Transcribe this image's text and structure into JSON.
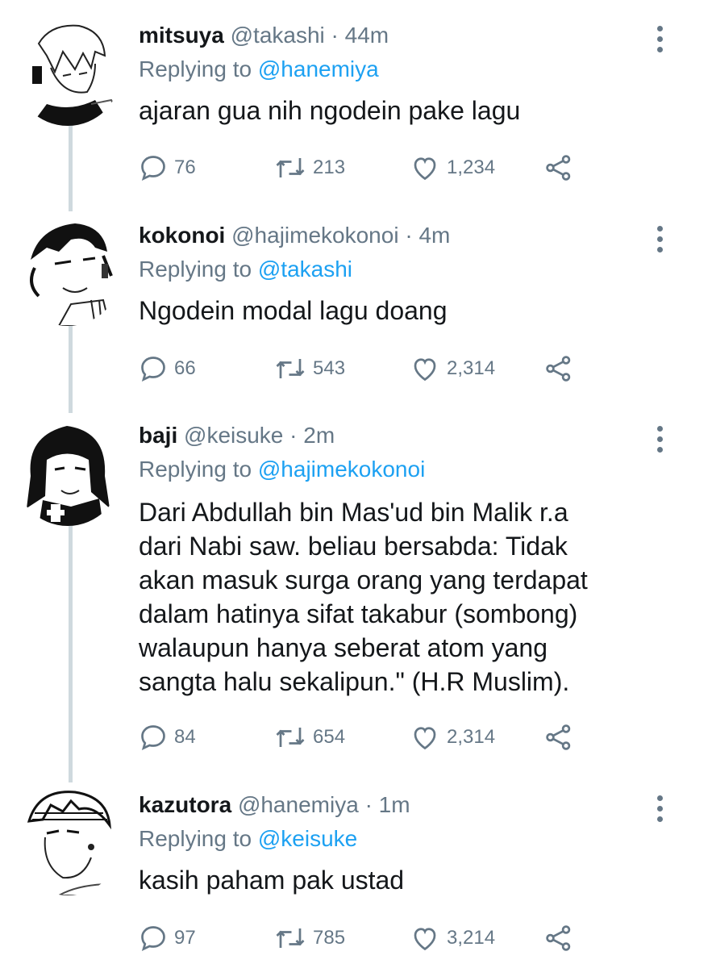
{
  "tweets": [
    {
      "name": "mitsuya",
      "handle": "@takashi",
      "separator": "·",
      "time": "44m",
      "replying_label": "Replying to",
      "replying_to": "@hanemiya",
      "text": "ajaran gua nih ngodein pake lagu",
      "replies": "76",
      "retweets": "213",
      "likes": "1,234",
      "icons": [
        "reply-icon",
        "retweet-icon",
        "like-icon",
        "share-icon",
        "more-icon"
      ]
    },
    {
      "name": "kokonoi",
      "handle": "@hajimekokonoi",
      "separator": "·",
      "time": "4m",
      "replying_label": "Replying to",
      "replying_to": "@takashi",
      "text": "Ngodein modal lagu doang",
      "replies": "66",
      "retweets": "543",
      "likes": "2,314",
      "icons": [
        "reply-icon",
        "retweet-icon",
        "like-icon",
        "share-icon",
        "more-icon"
      ]
    },
    {
      "name": "baji",
      "handle": "@keisuke",
      "separator": "·",
      "time": "2m",
      "replying_label": "Replying to",
      "replying_to": "@hajimekokonoi",
      "text_lines": [
        "Dari Abdullah bin Mas'ud bin Malik r.a",
        "dari Nabi saw. beliau bersabda: Tidak",
        "akan masuk surga orang yang terdapat",
        "dalam hatinya sifat takabur (sombong)",
        "walaupun hanya seberat atom yang",
        "sangta halu sekalipun.\" (H.R Muslim)."
      ],
      "replies": "84",
      "retweets": "654",
      "likes": "2,314",
      "icons": [
        "reply-icon",
        "retweet-icon",
        "like-icon",
        "share-icon",
        "more-icon"
      ]
    },
    {
      "name": "kazutora",
      "handle": "@hanemiya",
      "separator": "·",
      "time": "1m",
      "replying_label": "Replying to",
      "replying_to": "@keisuke",
      "text": "kasih paham pak ustad",
      "replies": "97",
      "retweets": "785",
      "likes": "3,214",
      "icons": [
        "reply-icon",
        "retweet-icon",
        "like-icon",
        "share-icon",
        "more-icon"
      ]
    }
  ],
  "colors": {
    "text": "#14171a",
    "secondary": "#657786",
    "mention": "#1da1f2",
    "thread_line": "#cfd9de"
  }
}
